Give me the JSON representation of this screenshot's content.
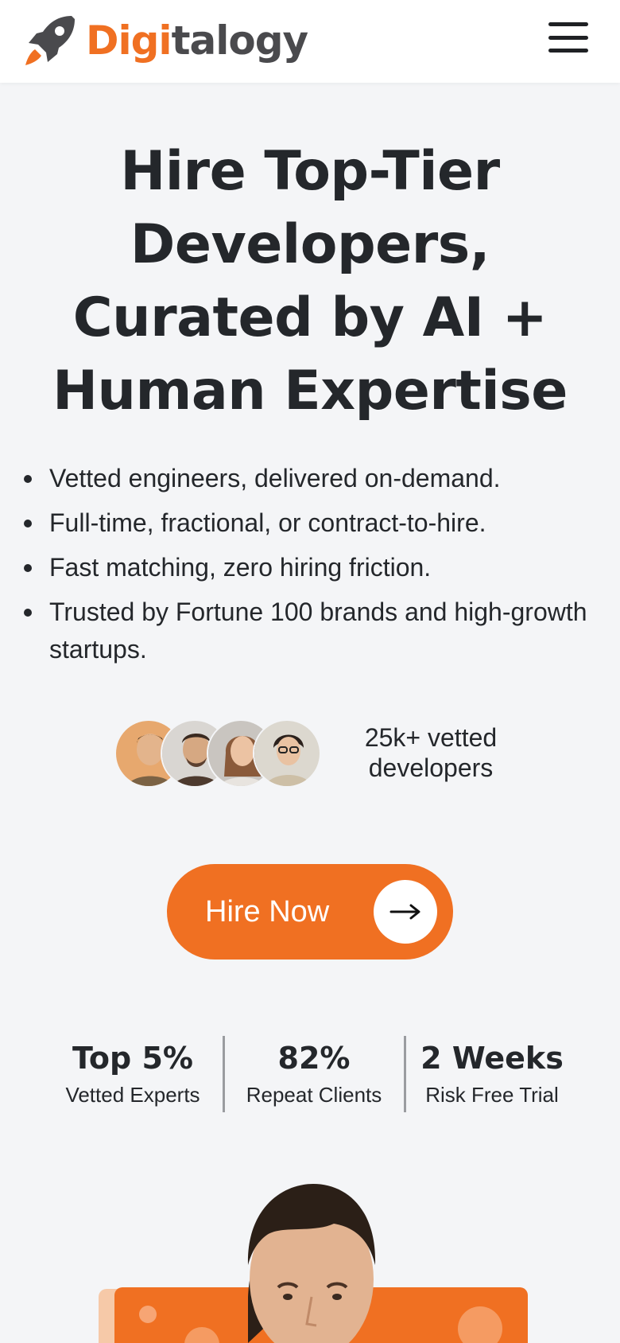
{
  "header": {
    "logo_part1": "Digi",
    "logo_part2": "talogy",
    "menu_icon": "hamburger-menu-icon"
  },
  "hero": {
    "title": "Hire Top-Tier Developers, Curated by AI + Human Expertise",
    "bullets": [
      "Vetted engineers, delivered on-demand.",
      "Full-time, fractional, or contract-to-hire.",
      "Fast matching, zero hiring friction.",
      "Trusted by Fortune 100 brands and high-growth startups."
    ]
  },
  "social_proof": {
    "developer_count_text": "25k+ vetted developers"
  },
  "cta": {
    "label": "Hire Now",
    "icon": "arrow-right-icon"
  },
  "stats": [
    {
      "value": "Top 5%",
      "label": "Vetted Experts"
    },
    {
      "value": "82%",
      "label": "Repeat Clients"
    },
    {
      "value": "2 Weeks",
      "label": "Risk Free Trial"
    }
  ],
  "colors": {
    "brand_orange": "#f07022",
    "logo_gray": "#4a4a4d",
    "text_dark": "#24272b",
    "page_bg": "#f4f5f7"
  }
}
